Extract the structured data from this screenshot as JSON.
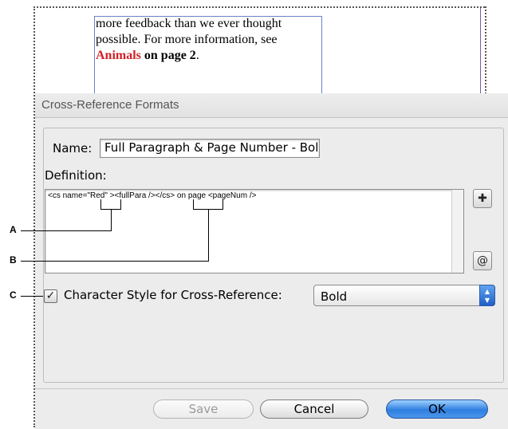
{
  "document": {
    "line1": "more feedback than we ever thought",
    "line2": "possible. For more information, see",
    "link_text": "Animals",
    "link_suffix": "on page 2",
    "period": "."
  },
  "dialog": {
    "title": "Cross-Reference Formats",
    "name_label": "Name:",
    "name_value": "Full Paragraph & Page Number - Bold",
    "definition_label": "Definition:",
    "definition_text": "<cs name=\"Red\" ><fullPara /></cs> on page <pageNum />",
    "char_style_label": "Character Style for Cross-Reference:",
    "char_style_checked": true,
    "char_style_value": "Bold",
    "buttons": {
      "save": "Save",
      "cancel": "Cancel",
      "ok": "OK"
    },
    "icons": {
      "insert_building_block": "building-block-icon",
      "insert_special_character": "special-character-icon"
    }
  },
  "callouts": [
    "A",
    "B",
    "C"
  ],
  "colors": {
    "link_red": "#d21f26",
    "ok_blue": "#2f7fe0",
    "frame_blue": "#6b83c7"
  }
}
